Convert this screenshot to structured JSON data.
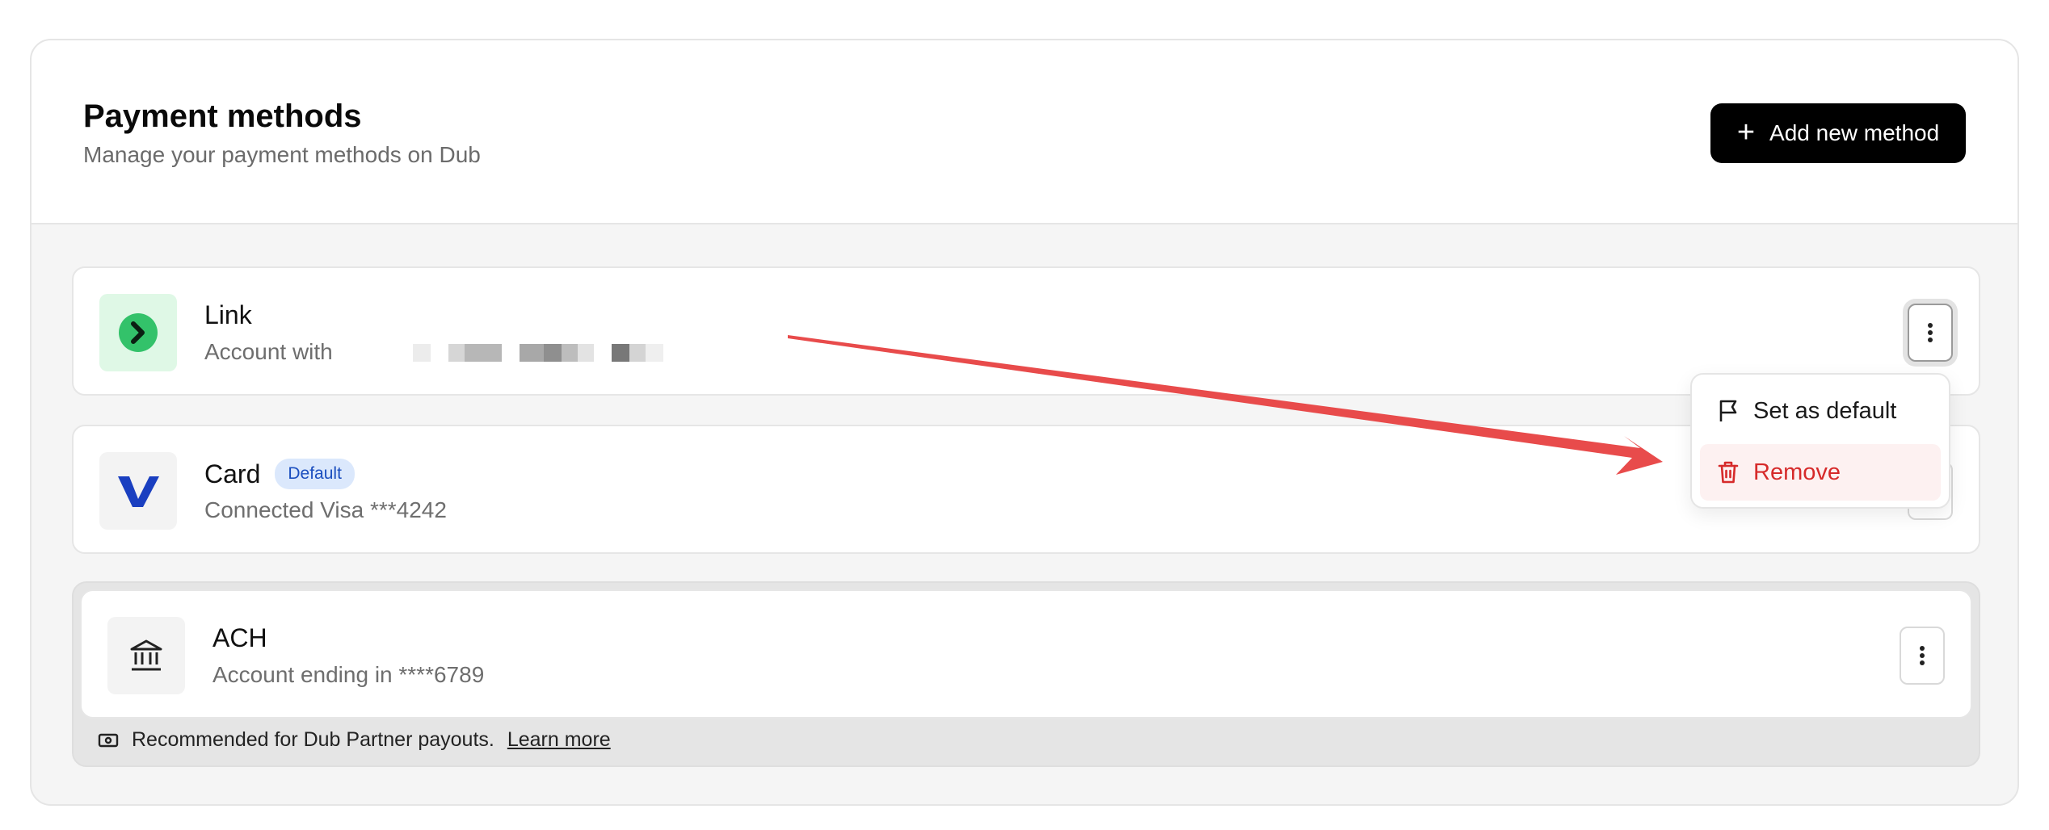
{
  "header": {
    "title": "Payment methods",
    "subtitle": "Manage your payment methods on Dub",
    "add_button": "Add new method"
  },
  "methods": [
    {
      "name": "Link",
      "detail": "Account with",
      "badge": "",
      "icon": "link-chevron-icon"
    },
    {
      "name": "Card",
      "detail": "Connected Visa ***4242",
      "badge": "Default",
      "icon": "visa-logo-icon"
    },
    {
      "name": "ACH",
      "detail": "Account ending in ****6789",
      "badge": "",
      "icon": "bank-icon"
    }
  ],
  "ach_note": {
    "text": "Recommended for Dub Partner payouts.",
    "link": "Learn more"
  },
  "menu": {
    "set_default": "Set as default",
    "remove": "Remove"
  },
  "colors": {
    "accent_black": "#000000",
    "danger": "#d62a2a",
    "badge_bg": "#dbe8fc",
    "badge_text": "#1c4fbf",
    "link_green": "#33c26a",
    "annotation_arrow": "#e84b4b"
  }
}
